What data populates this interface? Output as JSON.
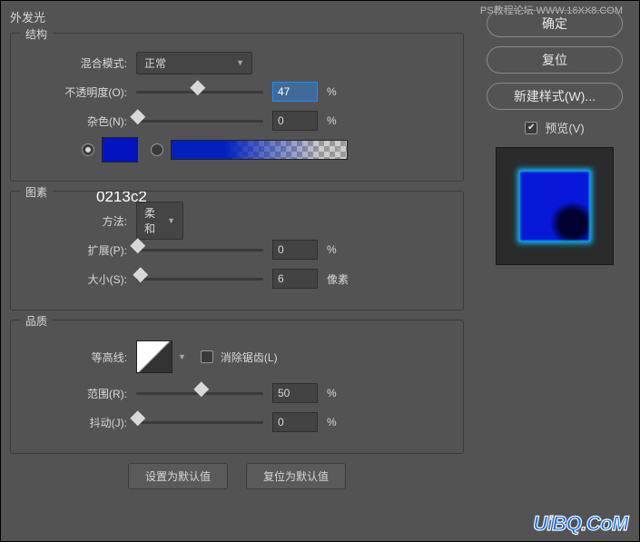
{
  "watermark": {
    "top": "PS教程论坛  WWW.16XX8.COM",
    "bottom": "UiBQ.CoM"
  },
  "panel_title": "外发光",
  "structure": {
    "title": "结构",
    "blend_label": "混合模式:",
    "blend_value": "正常",
    "opacity_label": "不透明度(O):",
    "opacity_value": "47",
    "opacity_unit": "%",
    "noise_label": "杂色(N):",
    "noise_value": "0",
    "noise_unit": "%",
    "hex": "0213c2"
  },
  "elements": {
    "title": "图素",
    "tech_label": "方法:",
    "tech_value": "柔和",
    "spread_label": "扩展(P):",
    "spread_value": "0",
    "spread_unit": "%",
    "size_label": "大小(S):",
    "size_value": "6",
    "size_unit": "像素"
  },
  "quality": {
    "title": "品质",
    "contour_label": "等高线:",
    "antialias_label": "消除锯齿(L)",
    "range_label": "范围(R):",
    "range_value": "50",
    "range_unit": "%",
    "jitter_label": "抖动(J):",
    "jitter_value": "0",
    "jitter_unit": "%"
  },
  "bottom": {
    "default": "设置为默认值",
    "reset": "复位为默认值"
  },
  "right": {
    "ok": "确定",
    "cancel": "复位",
    "new_style": "新建样式(W)...",
    "preview": "预览(V)"
  }
}
